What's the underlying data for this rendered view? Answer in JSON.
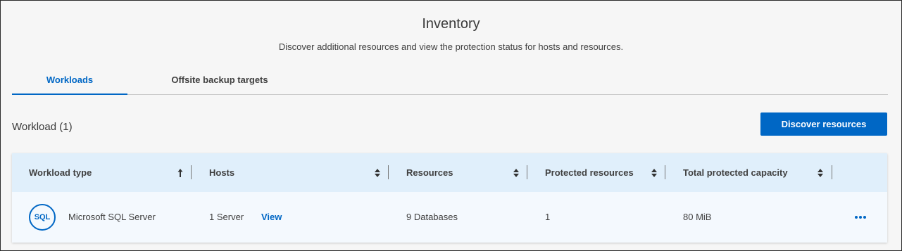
{
  "header": {
    "title": "Inventory",
    "subtitle": "Discover additional resources and view the protection status for hosts and resources."
  },
  "tabs": [
    {
      "label": "Workloads",
      "active": true
    },
    {
      "label": "Offsite backup targets",
      "active": false
    }
  ],
  "section": {
    "title": "Workload (1)",
    "discover_button": "Discover resources"
  },
  "table": {
    "columns": [
      {
        "label": "Workload type",
        "sort": "ascending"
      },
      {
        "label": "Hosts",
        "sort": "none"
      },
      {
        "label": "Resources",
        "sort": "none"
      },
      {
        "label": "Protected resources",
        "sort": "none"
      },
      {
        "label": "Total protected capacity",
        "sort": "none"
      }
    ],
    "rows": [
      {
        "icon_text": "SQL",
        "workload_type": "Microsoft SQL Server",
        "hosts": "1 Server",
        "hosts_link": "View",
        "resources": "9 Databases",
        "protected_resources": "1",
        "total_protected_capacity": "80 MiB",
        "actions_icon": "more-horizontal-icon"
      }
    ]
  },
  "colors": {
    "accent": "#0067c5",
    "header_row": "#e0effb",
    "body_row": "#f4f9fe",
    "page_bg": "#f6f6f6"
  }
}
